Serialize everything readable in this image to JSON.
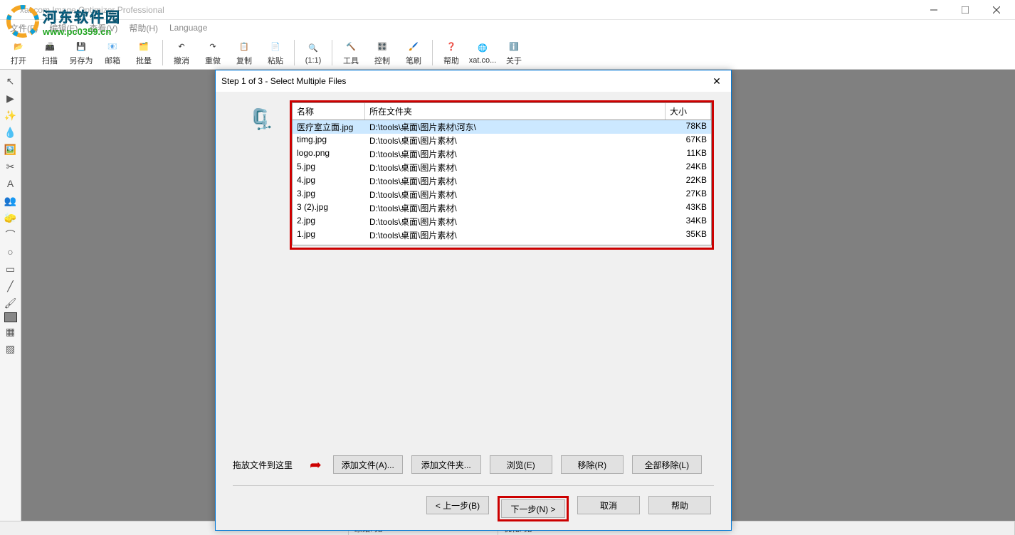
{
  "titlebar": {
    "text": "xat.com  Image Optimizer Professional"
  },
  "watermark": {
    "cn": "河东软件园",
    "url": "www.pc0359.cn"
  },
  "menu": {
    "file": "文件(F)",
    "edit": "编辑(E)",
    "view": "查看(V)",
    "help": "帮助(H)",
    "language": "Language"
  },
  "toolbar": {
    "open": "打开",
    "scan": "扫描",
    "saveas": "另存为",
    "mail": "邮箱",
    "batch": "批量",
    "undo": "撤消",
    "redo": "重做",
    "copy": "复制",
    "paste": "粘贴",
    "oneone": "(1:1)",
    "tools": "工具",
    "control": "控制",
    "brush": "笔刷",
    "help": "帮助",
    "xatco": "xat.co...",
    "about": "关于"
  },
  "dialog": {
    "title": "Step 1 of 3 - Select Multiple Files",
    "col_name": "名称",
    "col_folder": "所在文件夹",
    "col_size": "大小",
    "files": [
      {
        "name": "医疗室立面.jpg",
        "folder": "D:\\tools\\桌面\\图片素材\\河东\\",
        "size": "78KB",
        "sel": true
      },
      {
        "name": "timg.jpg",
        "folder": "D:\\tools\\桌面\\图片素材\\",
        "size": "67KB"
      },
      {
        "name": "logo.png",
        "folder": "D:\\tools\\桌面\\图片素材\\",
        "size": "11KB"
      },
      {
        "name": "5.jpg",
        "folder": "D:\\tools\\桌面\\图片素材\\",
        "size": "24KB"
      },
      {
        "name": "4.jpg",
        "folder": "D:\\tools\\桌面\\图片素材\\",
        "size": "22KB"
      },
      {
        "name": "3.jpg",
        "folder": "D:\\tools\\桌面\\图片素材\\",
        "size": "27KB"
      },
      {
        "name": "3 (2).jpg",
        "folder": "D:\\tools\\桌面\\图片素材\\",
        "size": "43KB"
      },
      {
        "name": "2.jpg",
        "folder": "D:\\tools\\桌面\\图片素材\\",
        "size": "34KB"
      },
      {
        "name": "1.jpg",
        "folder": "D:\\tools\\桌面\\图片素材\\",
        "size": "35KB"
      }
    ],
    "drag_hint": "拖放文件到这里",
    "btn_add_file": "添加文件(A)...",
    "btn_add_folder": "添加文件夹...",
    "btn_browse": "浏览(E)",
    "btn_remove": "移除(R)",
    "btn_remove_all": "全部移除(L)",
    "btn_prev": "< 上一步(B)",
    "btn_next": "下一步(N) >",
    "btn_cancel": "取消",
    "btn_help": "帮助"
  },
  "status": {
    "orig": "原始: 无",
    "opt": "优化: 无"
  }
}
